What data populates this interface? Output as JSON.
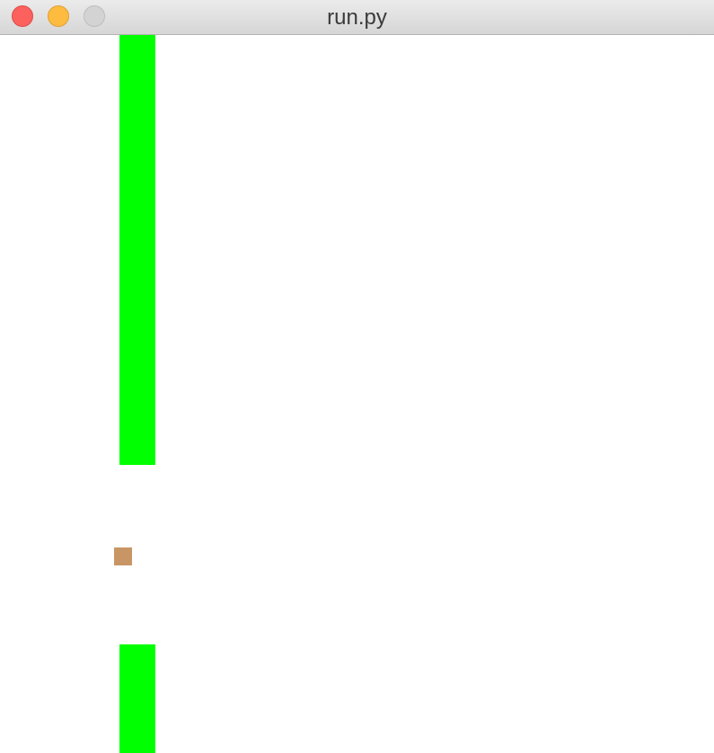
{
  "window": {
    "title": "run.py"
  },
  "game": {
    "background_color": "#ffffff",
    "pipe_color": "#00ff00",
    "bird_color": "#c89664"
  }
}
